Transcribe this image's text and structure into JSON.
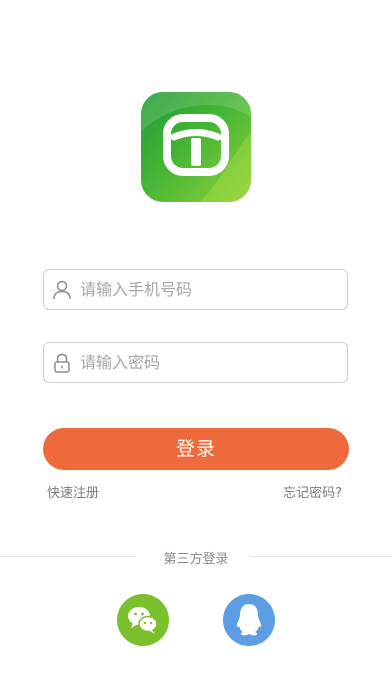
{
  "login_form": {
    "phone_placeholder": "请输入手机号码",
    "password_placeholder": "请输入密码",
    "login_label": "登录",
    "register_label": "快速注册",
    "forgot_label": "忘记密码?"
  },
  "third_party": {
    "title": "第三方登录",
    "providers": [
      {
        "icon": "wechat-icon",
        "color": "#7ac02c"
      },
      {
        "icon": "qq-icon",
        "color": "#5d9de3"
      }
    ]
  },
  "colors": {
    "accent": "#ee6a3c",
    "brand_green": "#46b535"
  }
}
